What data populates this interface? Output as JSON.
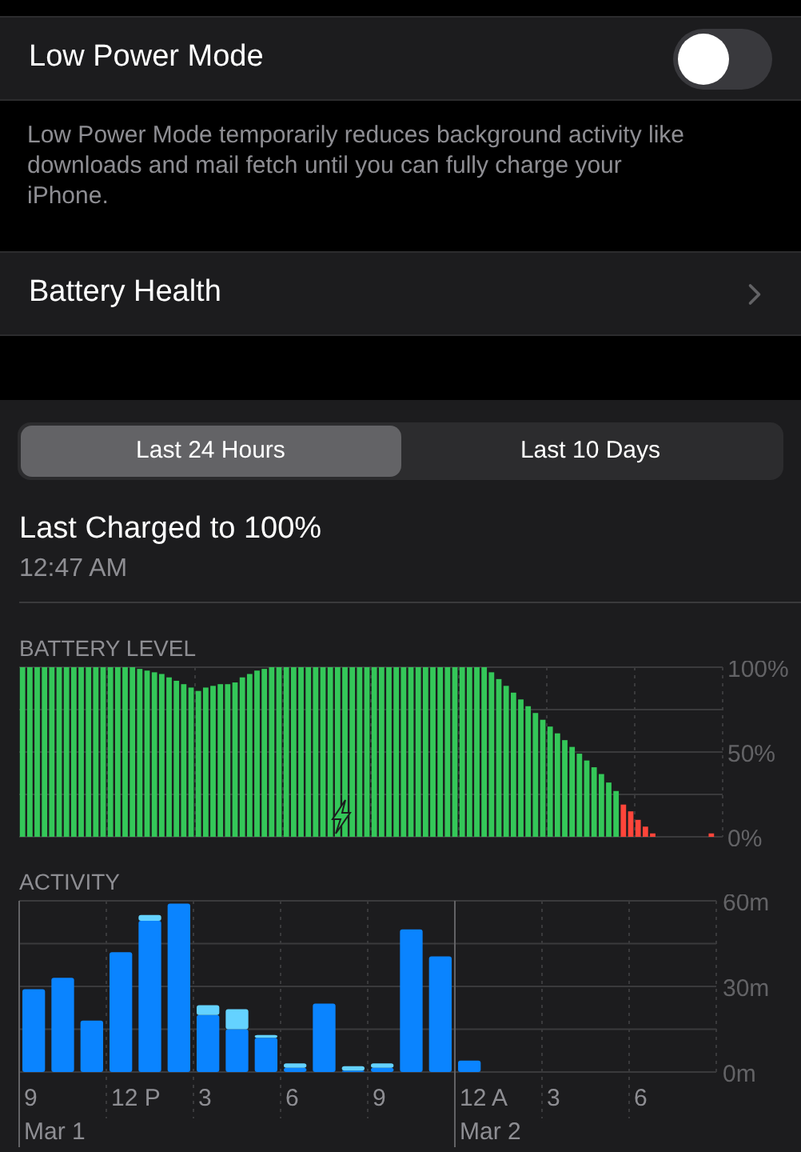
{
  "low_power": {
    "label": "Low Power Mode",
    "on": false,
    "description": "Low Power Mode temporarily reduces background activity like downloads and mail fetch until you can fully charge your iPhone."
  },
  "battery_health": {
    "label": "Battery Health"
  },
  "tabs": [
    {
      "label": "Last 24 Hours",
      "selected": true
    },
    {
      "label": "Last 10 Days",
      "selected": false
    }
  ],
  "last_charged": {
    "title": "Last Charged to 100%",
    "time": "12:47 AM"
  },
  "battery_level": {
    "chart_data": {
      "type": "bar",
      "title": "BATTERY LEVEL",
      "ylim": [
        0,
        100
      ],
      "yticks": [
        {
          "value": 0,
          "label": "0%"
        },
        {
          "value": 50,
          "label": "50%"
        },
        {
          "value": 100,
          "label": "100%"
        }
      ],
      "series": [
        {
          "color": "#34c759",
          "values": [
            100,
            100,
            100,
            100,
            100,
            100,
            100,
            100,
            100,
            100,
            100,
            100,
            100,
            100,
            100,
            100,
            99,
            98,
            97,
            96,
            94,
            92,
            90,
            88,
            86,
            88,
            89,
            90,
            90,
            91,
            94,
            96,
            98,
            99,
            100,
            100,
            100,
            100,
            100,
            100,
            100,
            100,
            100,
            100,
            100,
            100,
            100,
            100,
            100,
            100,
            100,
            100,
            100,
            100,
            100,
            100,
            100,
            100,
            100,
            100,
            100,
            100,
            100,
            100,
            97,
            93,
            89,
            85,
            81,
            77,
            73,
            69,
            65,
            61,
            57,
            53,
            49,
            45,
            41,
            37,
            32,
            27,
            null,
            null,
            null,
            null,
            null,
            null,
            null,
            null,
            null,
            null,
            null,
            null,
            null,
            null
          ]
        },
        {
          "color": "#ff453a",
          "values": [
            null,
            null,
            null,
            null,
            null,
            null,
            null,
            null,
            null,
            null,
            null,
            null,
            null,
            null,
            null,
            null,
            null,
            null,
            null,
            null,
            null,
            null,
            null,
            null,
            null,
            null,
            null,
            null,
            null,
            null,
            null,
            null,
            null,
            null,
            null,
            null,
            null,
            null,
            null,
            null,
            null,
            null,
            null,
            null,
            null,
            null,
            null,
            null,
            null,
            null,
            null,
            null,
            null,
            null,
            null,
            null,
            null,
            null,
            null,
            null,
            null,
            null,
            null,
            null,
            null,
            null,
            null,
            null,
            null,
            null,
            null,
            null,
            null,
            null,
            null,
            null,
            null,
            null,
            null,
            null,
            null,
            null,
            19,
            15,
            10,
            6,
            2,
            null,
            null,
            null,
            null,
            null,
            null,
            null,
            2,
            null
          ]
        }
      ]
    }
  },
  "activity": {
    "chart_data": {
      "type": "bar",
      "title": "ACTIVITY",
      "stacked": true,
      "ylim": [
        0,
        60
      ],
      "yticks": [
        {
          "value": 0,
          "label": "0m"
        },
        {
          "value": 30,
          "label": "30m"
        },
        {
          "value": 60,
          "label": "60m"
        }
      ],
      "categories": [
        "9",
        null,
        null,
        "12 P",
        null,
        null,
        "3",
        null,
        null,
        "6",
        null,
        null,
        "9",
        null,
        null,
        "12 A",
        null,
        null,
        "3",
        null,
        null,
        "6",
        null,
        null
      ],
      "series": [
        {
          "color": "#0a84ff",
          "values": [
            29,
            33,
            18,
            42,
            53,
            59,
            20,
            15,
            12,
            1.5,
            24,
            0.5,
            1.5,
            50,
            40.5,
            4,
            0,
            0,
            0,
            0,
            0,
            0,
            0,
            0
          ]
        },
        {
          "color": "#64d2ff",
          "values": [
            0,
            0,
            0,
            0,
            2,
            0,
            3.4,
            7,
            1,
            1.5,
            0,
            1.5,
            1.5,
            0,
            0,
            0,
            0,
            0,
            0,
            0,
            0,
            0,
            0,
            0
          ]
        }
      ]
    },
    "dates": [
      {
        "label": "Mar 1"
      },
      {
        "label": "Mar 2"
      }
    ]
  }
}
